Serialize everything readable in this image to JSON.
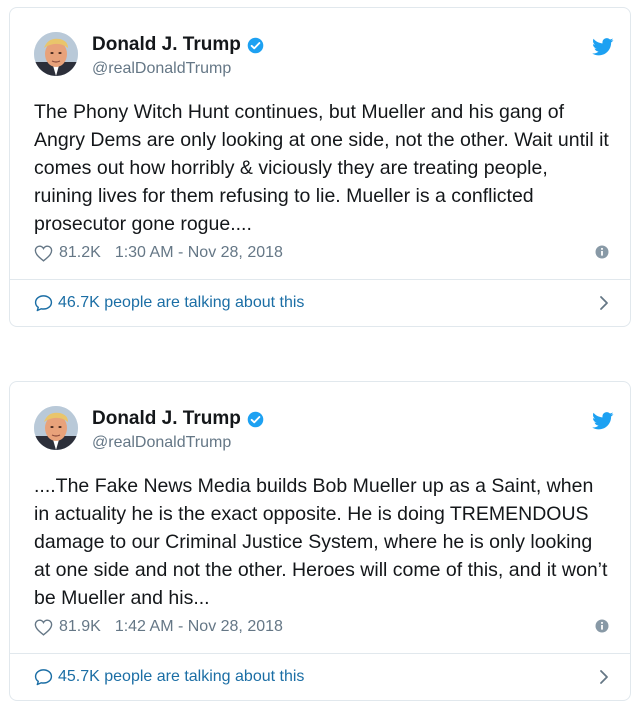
{
  "accent_color": "#1da1f2",
  "link_color": "#1b6ea5",
  "tweets": [
    {
      "author": {
        "name": "Donald J. Trump",
        "handle": "@realDonaldTrump",
        "verified": true
      },
      "text": "The Phony Witch Hunt continues, but Mueller and his gang of Angry Dems are only looking at one side, not the other. Wait until it comes out how horribly & viciously they are treating people, ruining lives for them refusing to lie. Mueller is a conflicted prosecutor gone rogue....",
      "likes": "81.2K",
      "timestamp": "1:30 AM - Nov 28, 2018",
      "talking": "46.7K people are talking about this"
    },
    {
      "author": {
        "name": "Donald J. Trump",
        "handle": "@realDonaldTrump",
        "verified": true
      },
      "text": "....The Fake News Media builds Bob Mueller up as a Saint, when in actuality he is the exact opposite. He is doing TREMENDOUS damage to our Criminal Justice System, where he is only looking at one side and not the other. Heroes will come of this, and it won’t be Mueller and his...",
      "likes": "81.9K",
      "timestamp": "1:42 AM - Nov 28, 2018",
      "talking": "45.7K people are talking about this"
    }
  ]
}
